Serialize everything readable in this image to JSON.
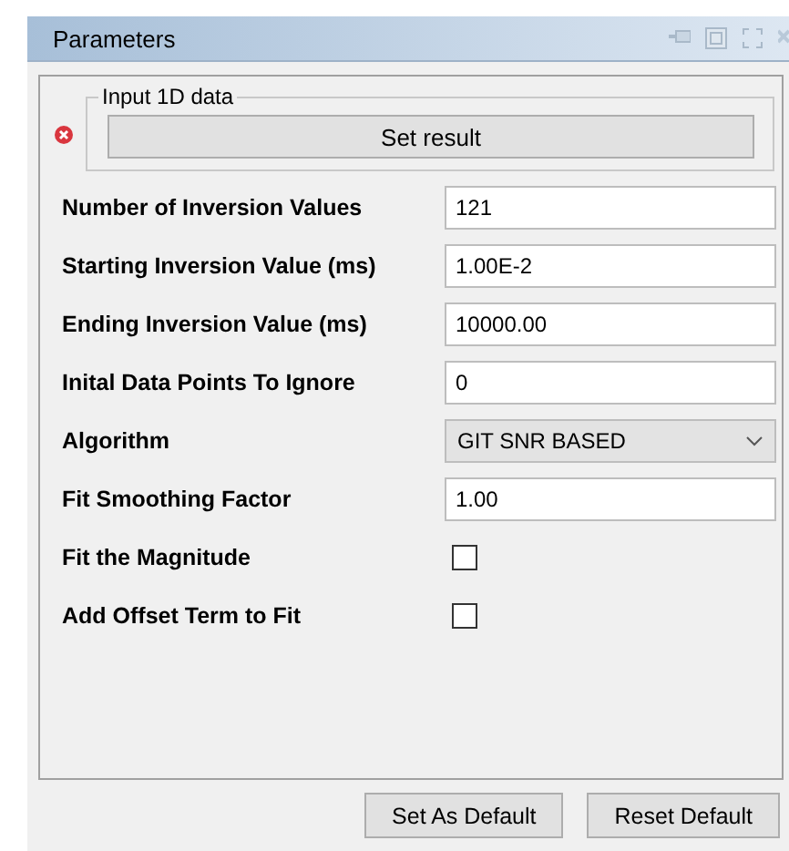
{
  "window": {
    "title": "Parameters"
  },
  "input_group": {
    "title": "Input 1D data",
    "error": true,
    "button": "Set result"
  },
  "fields": [
    {
      "kind": "text",
      "label": "Number of Inversion Values",
      "value": "121"
    },
    {
      "kind": "text",
      "label": "Starting Inversion Value (ms)",
      "value": "1.00E-2"
    },
    {
      "kind": "text",
      "label": "Ending Inversion Value (ms)",
      "value": "10000.00"
    },
    {
      "kind": "text",
      "label": "Inital Data Points To Ignore",
      "value": "0"
    },
    {
      "kind": "select",
      "label": "Algorithm",
      "value": "GIT SNR BASED"
    },
    {
      "kind": "text",
      "label": "Fit Smoothing Factor",
      "value": "1.00"
    },
    {
      "kind": "checkbox",
      "label": "Fit the Magnitude",
      "checked": false
    },
    {
      "kind": "checkbox",
      "label": "Add Offset Term to Fit",
      "checked": false
    }
  ],
  "buttons": [
    "Set As Default",
    "Reset Default"
  ]
}
